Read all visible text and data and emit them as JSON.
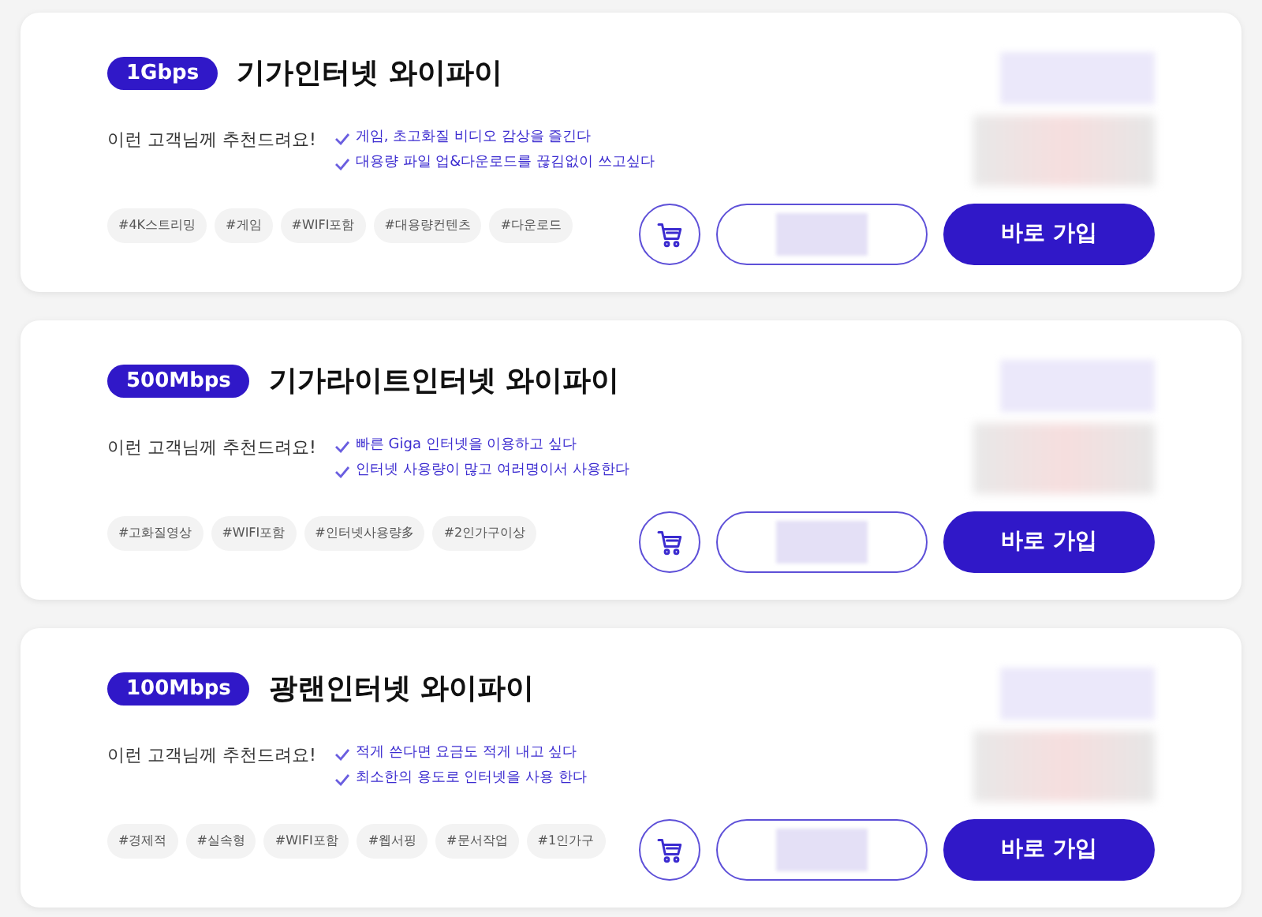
{
  "plans": [
    {
      "speed": "1Gbps",
      "title": "기가인터넷 와이파이",
      "recommend_label": "이런 고객님께 추천드려요!",
      "points": [
        "게임, 초고화질 비디오 감상을 즐긴다",
        "대용량 파일 업&다운로드를 끊김없이 쓰고싶다"
      ],
      "tags": [
        "#4K스트리밍",
        "#게임",
        "#WIFI포함",
        "#대용량컨텐츠",
        "#다운로드"
      ],
      "join_button": "바로 가입"
    },
    {
      "speed": "500Mbps",
      "title": "기가라이트인터넷 와이파이",
      "recommend_label": "이런 고객님께 추천드려요!",
      "points": [
        "빠른 Giga 인터넷을 이용하고 싶다",
        "인터넷 사용량이 많고 여러명이서 사용한다"
      ],
      "tags": [
        "#고화질영상",
        "#WIFI포함",
        "#인터넷사용량多",
        "#2인가구이상"
      ],
      "join_button": "바로 가입"
    },
    {
      "speed": "100Mbps",
      "title": "광랜인터넷 와이파이",
      "recommend_label": "이런 고객님께 추천드려요!",
      "points": [
        "적게 쓴다면 요금도 적게 내고 싶다",
        "최소한의 용도로 인터넷을 사용 한다"
      ],
      "tags": [
        "#경제적",
        "#실속형",
        "#WIFI포함",
        "#웹서핑",
        "#문서작업",
        "#1인가구"
      ],
      "join_button": "바로 가입"
    }
  ]
}
